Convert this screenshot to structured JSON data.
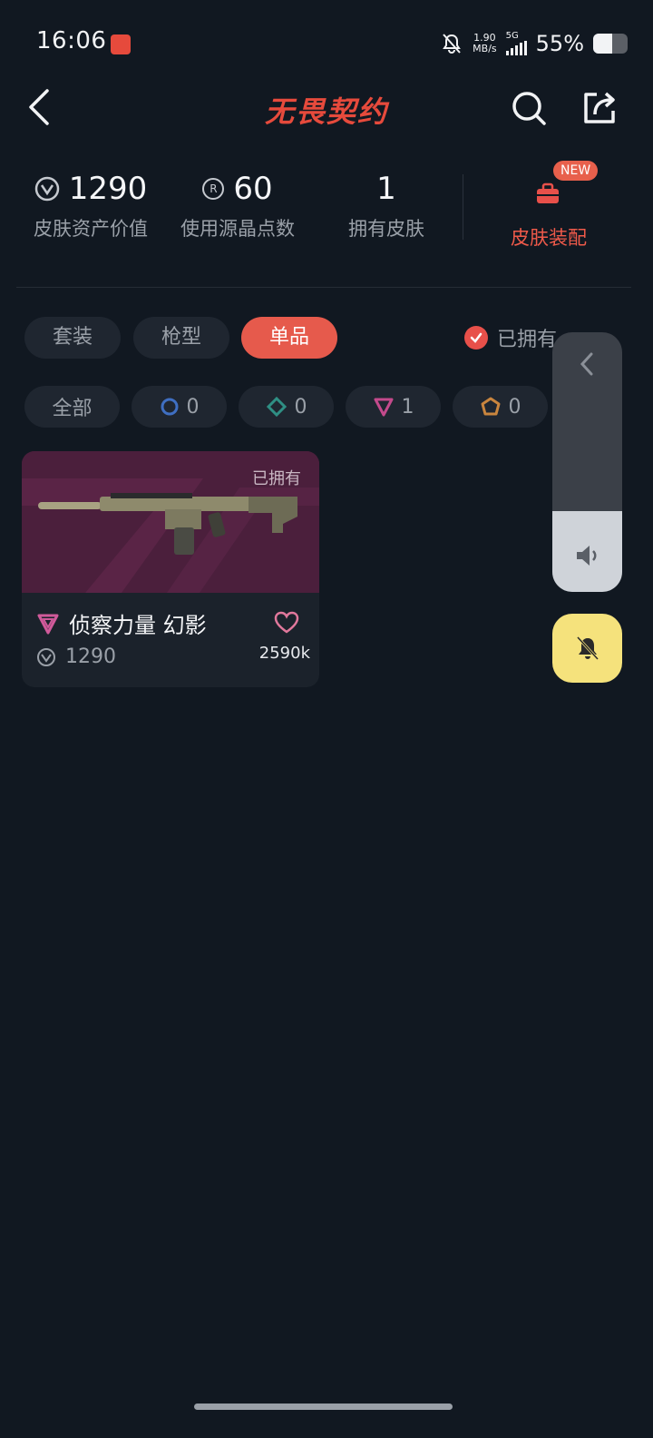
{
  "status_bar": {
    "time": "16:06",
    "net_speed_value": "1.90",
    "net_speed_unit": "MB/s",
    "network": "5G",
    "battery_pct": "55%",
    "battery_level": 0.55
  },
  "header": {
    "title": "无畏契约"
  },
  "stats": [
    {
      "value": "1290",
      "label": "皮肤资产价值",
      "icon": "valorant-points-icon"
    },
    {
      "value": "60",
      "label": "使用源晶点数",
      "icon": "radianite-icon"
    },
    {
      "value": "1",
      "label": "拥有皮肤"
    }
  ],
  "loadout": {
    "label": "皮肤装配",
    "badge": "NEW",
    "icon": "toolbox-icon"
  },
  "tabs": [
    {
      "label": "套装",
      "active": false
    },
    {
      "label": "枪型",
      "active": false
    },
    {
      "label": "单品",
      "active": true
    }
  ],
  "owned_filter": {
    "label": "已拥有",
    "checked": true
  },
  "rarity_chips": [
    {
      "label": "全部"
    },
    {
      "count": "0",
      "icon": "select-tier-icon",
      "color": "#3f6fc2"
    },
    {
      "count": "0",
      "icon": "deluxe-tier-icon",
      "color": "#2f8f84"
    },
    {
      "count": "1",
      "icon": "premium-tier-icon",
      "color": "#c44a8c"
    },
    {
      "count": "0",
      "icon": "exclusive-tier-icon",
      "color": "#c9853e"
    }
  ],
  "card": {
    "owned_tag": "已拥有",
    "name": "侦察力量 幻影",
    "price": "1290",
    "likes": "2590k",
    "tier_color": "#d05a9a"
  },
  "colors": {
    "accent": "#e65a4c",
    "background": "#111821",
    "bell_button": "#f5e27c"
  },
  "volume_panel": {
    "level": 0.31
  }
}
